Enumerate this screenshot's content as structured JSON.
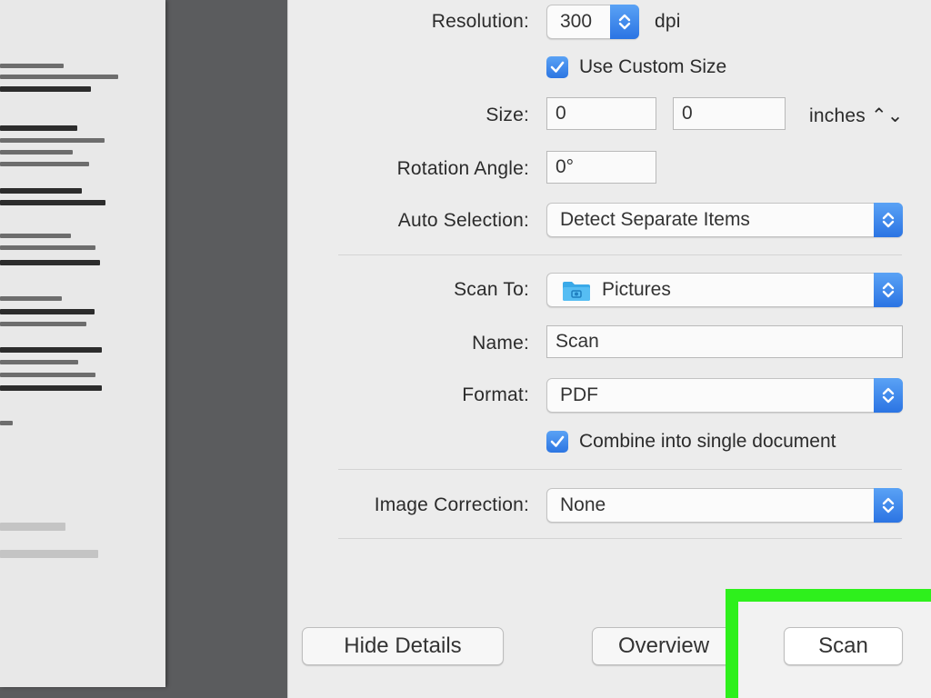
{
  "scanner": {
    "resolution": {
      "label": "Resolution:",
      "value": "300",
      "unit": "dpi"
    },
    "custom_size": {
      "label": "Use Custom Size",
      "checked": true
    },
    "size": {
      "label": "Size:",
      "width": "0",
      "height": "0",
      "unit": "inches ⌃⌄"
    },
    "rotation": {
      "label": "Rotation Angle:",
      "value": "0°"
    },
    "auto_selection": {
      "label": "Auto Selection:",
      "value": "Detect Separate Items"
    },
    "scan_to": {
      "label": "Scan To:",
      "value": "Pictures"
    },
    "name": {
      "label": "Name:",
      "value": "Scan"
    },
    "format": {
      "label": "Format:",
      "value": "PDF"
    },
    "combine": {
      "label": "Combine into single document",
      "checked": true
    },
    "image_correction": {
      "label": "Image Correction:",
      "value": "None"
    }
  },
  "buttons": {
    "hide_details": "Hide Details",
    "overview": "Overview",
    "scan": "Scan"
  },
  "colors": {
    "accent": "#2b74e3",
    "highlight": "#2ef01c"
  }
}
